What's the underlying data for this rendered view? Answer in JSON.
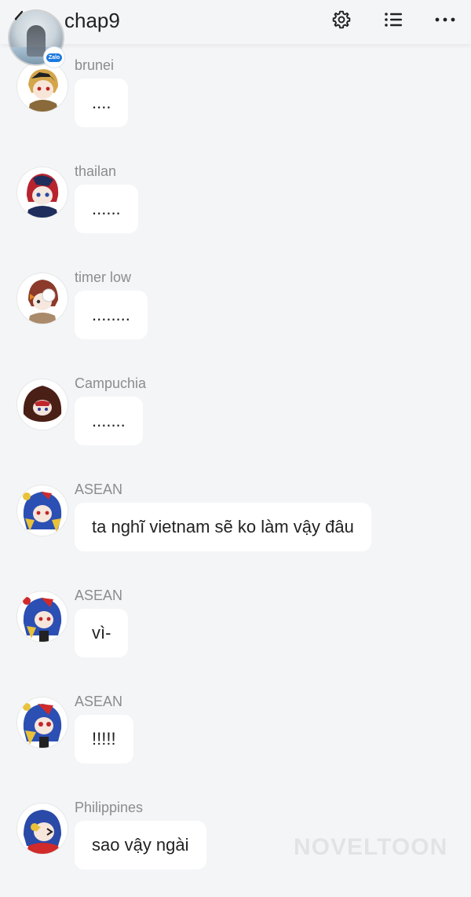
{
  "header": {
    "title": "chap9",
    "badge_label": "Zalo",
    "back_icon": "chevron-left-icon",
    "settings_icon": "gear-icon",
    "list_icon": "list-icon",
    "more_icon": "more-horizontal-icon"
  },
  "messages": [
    {
      "sender": "brunei",
      "text": "...."
    },
    {
      "sender": "thailan",
      "text": "......"
    },
    {
      "sender": "timer low",
      "text": "........"
    },
    {
      "sender": "Campuchia",
      "text": "......."
    },
    {
      "sender": "ASEAN",
      "text": "ta nghĩ vietnam sẽ ko làm vậy đâu"
    },
    {
      "sender": "ASEAN",
      "text": "vì-"
    },
    {
      "sender": "ASEAN",
      "text": "!!!!!"
    },
    {
      "sender": "Philippines",
      "text": "sao vậy ngài"
    }
  ],
  "watermark": "NOVELTOON",
  "colors": {
    "background": "#f4f5f7",
    "bubble": "#ffffff",
    "sender_text": "#8c8c8c",
    "message_text": "#222222"
  }
}
